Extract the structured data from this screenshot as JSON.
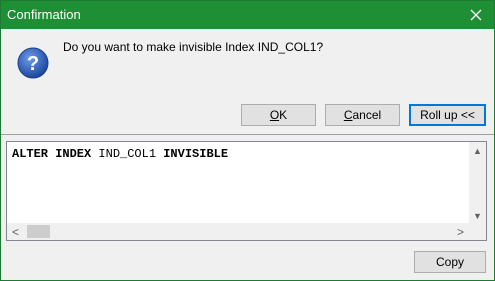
{
  "window": {
    "title": "Confirmation",
    "close_glyph": "✕"
  },
  "message": "Do you want to make invisible Index IND_COL1?",
  "buttons": {
    "ok": {
      "mnemonic": "O",
      "rest": "K"
    },
    "cancel": {
      "mnemonic": "C",
      "rest": "ancel"
    },
    "rollup": "Roll up <<",
    "copy": "Copy"
  },
  "sql": {
    "kw1": "ALTER INDEX",
    "name": "IND_COL1",
    "kw2": "INVISIBLE"
  },
  "scroll": {
    "up": "▲",
    "down": "▼",
    "left": "<",
    "right": ">"
  },
  "icons": {
    "question": "question-icon",
    "close": "close-icon"
  },
  "colors": {
    "titlebar": "#1f8f35",
    "icon_blue": "#1f56b4",
    "focus_border": "#0078d7"
  }
}
